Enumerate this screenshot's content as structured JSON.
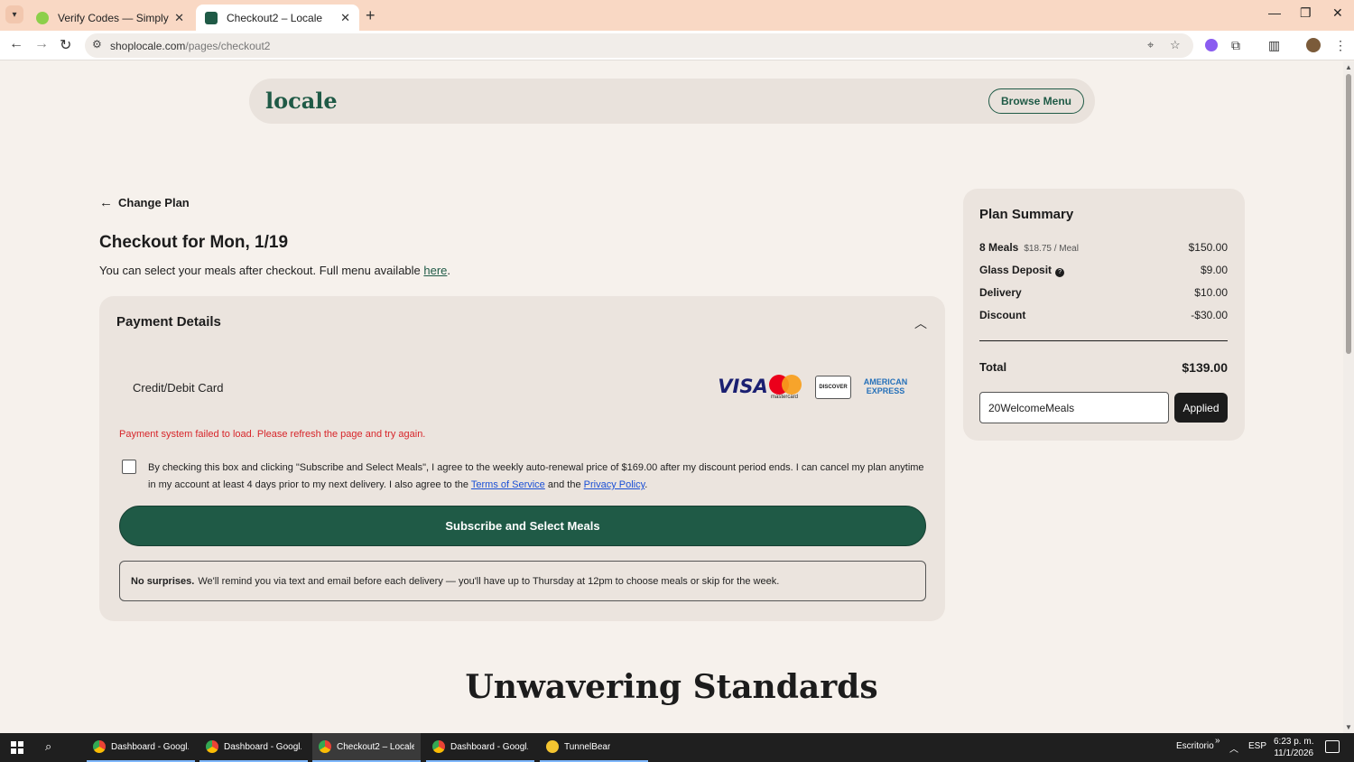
{
  "browser": {
    "tabs": [
      {
        "title": "Verify Codes — SimplyCodes"
      },
      {
        "title": "Checkout2 – Locale"
      }
    ],
    "url_host": "shoplocale.com",
    "url_path": "/pages/checkout2"
  },
  "header": {
    "logo": "locale",
    "browse_label": "Browse Menu"
  },
  "checkout": {
    "back_label": "Change Plan",
    "title": "Checkout for Mon, 1/19",
    "subtitle_prefix": "You can select your meals after checkout. Full menu available ",
    "subtitle_link": "here",
    "subtitle_suffix": "."
  },
  "payment": {
    "title": "Payment Details",
    "card_label": "Credit/Debit Card",
    "brands": {
      "visa": "VISA",
      "mastercard": "mastercard",
      "discover": "DISCOVER",
      "amex_line1": "AMERICAN",
      "amex_line2": "EXPRESS"
    },
    "error": "Payment system failed to load. Please refresh the page and try again.",
    "agree_prefix": "By checking this box and clicking \"Subscribe and Select Meals\", I agree to the weekly auto-renewal price of $169.00 after my discount period ends. I can cancel my plan anytime in my account at least 4 days prior to my next delivery. I also agree to the ",
    "agree_terms": "Terms of Service",
    "agree_mid": " and the ",
    "agree_privacy": "Privacy Policy",
    "agree_suffix": ".",
    "subscribe_label": "Subscribe and Select Meals",
    "notice_bold": "No surprises.",
    "notice_text": "We'll remind you via text and email before each delivery — you'll have up to Thursday at 12pm to choose meals or skip for the week."
  },
  "summary": {
    "title": "Plan Summary",
    "rows": [
      {
        "label": "8 Meals",
        "sub": "$18.75 / Meal",
        "value": "$150.00"
      },
      {
        "label": "Glass Deposit",
        "value": "$9.00"
      },
      {
        "label": "Delivery",
        "value": "$10.00"
      },
      {
        "label": "Discount",
        "value": "-$30.00"
      }
    ],
    "total_label": "Total",
    "total_value": "$139.00",
    "promo_value": "20WelcomeMeals",
    "apply_label": "Applied"
  },
  "section_heading": "Unwavering Standards",
  "taskbar": {
    "items": [
      {
        "label": "Dashboard - Googl..."
      },
      {
        "label": "Dashboard - Googl..."
      },
      {
        "label": "Checkout2 – Locale..."
      },
      {
        "label": "Dashboard - Googl..."
      },
      {
        "label": "TunnelBear"
      }
    ],
    "desktop": "Escritorio",
    "lang": "ESP",
    "time": "6:23 p. m.",
    "date": "11/1/2026"
  }
}
